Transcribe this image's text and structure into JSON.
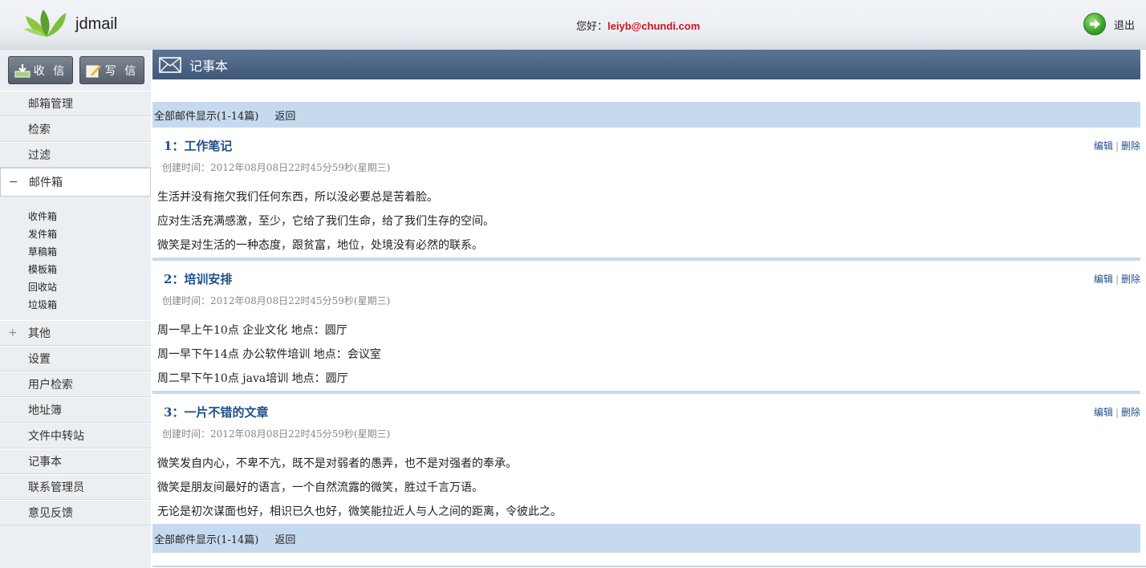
{
  "header": {
    "logo_text": "jdmail",
    "greeting_label": "您好：",
    "user_email": "leiyb@chundi.com",
    "logout_label": "退出"
  },
  "sidebar": {
    "inbox_button": "收 信",
    "compose_button": "写 信",
    "top_items": [
      "邮箱管理",
      "检索",
      "过滤"
    ],
    "mailbox": {
      "sign": "−",
      "label": "邮件箱"
    },
    "folders": [
      "收件箱",
      "发件箱",
      "草稿箱",
      "模板箱",
      "回收站",
      "垃圾箱"
    ],
    "other": {
      "sign": "+",
      "label": "其他"
    },
    "bottom_items": [
      "设置",
      "用户检索",
      "地址簿",
      "文件中转站",
      "记事本",
      "联系管理员",
      "意见反馈"
    ]
  },
  "main": {
    "title": "记事本",
    "pager_text": "全部邮件显示(1-14篇)",
    "back_label": "返回",
    "edit_label": "编辑",
    "delete_label": "删除",
    "notes": [
      {
        "title": "1：工作笔记",
        "time": "创建时间：2012年08月08日22时45分59秒(星期三)",
        "lines": [
          "生活并没有拖欠我们任何东西，所以没必要总是苦着脸。",
          "应对生活充满感激，至少，它给了我们生命，给了我们生存的空间。",
          "微笑是对生活的一种态度，跟贫富，地位，处境没有必然的联系。"
        ]
      },
      {
        "title": "2：培训安排",
        "time": "创建时间：2012年08月08日22时45分59秒(星期三)",
        "lines": [
          "周一早上午10点  企业文化  地点：圆厅",
          "周一早下午14点  办公软件培训  地点：会议室",
          "周二早下午10点  java培训  地点：圆厅"
        ]
      },
      {
        "title": "3：一片不错的文章",
        "time": "创建时间：2012年08月08日22时45分59秒(星期三)",
        "lines": [
          "微笑发自内心，不卑不亢，既不是对弱者的愚弄，也不是对强者的奉承。",
          "微笑是朋友间最好的语言，一个自然流露的微笑，胜过千言万语。",
          "无论是初次谋面也好，相识已久也好，微笑能拉近人与人之间的距离，令彼此之。"
        ]
      }
    ]
  }
}
